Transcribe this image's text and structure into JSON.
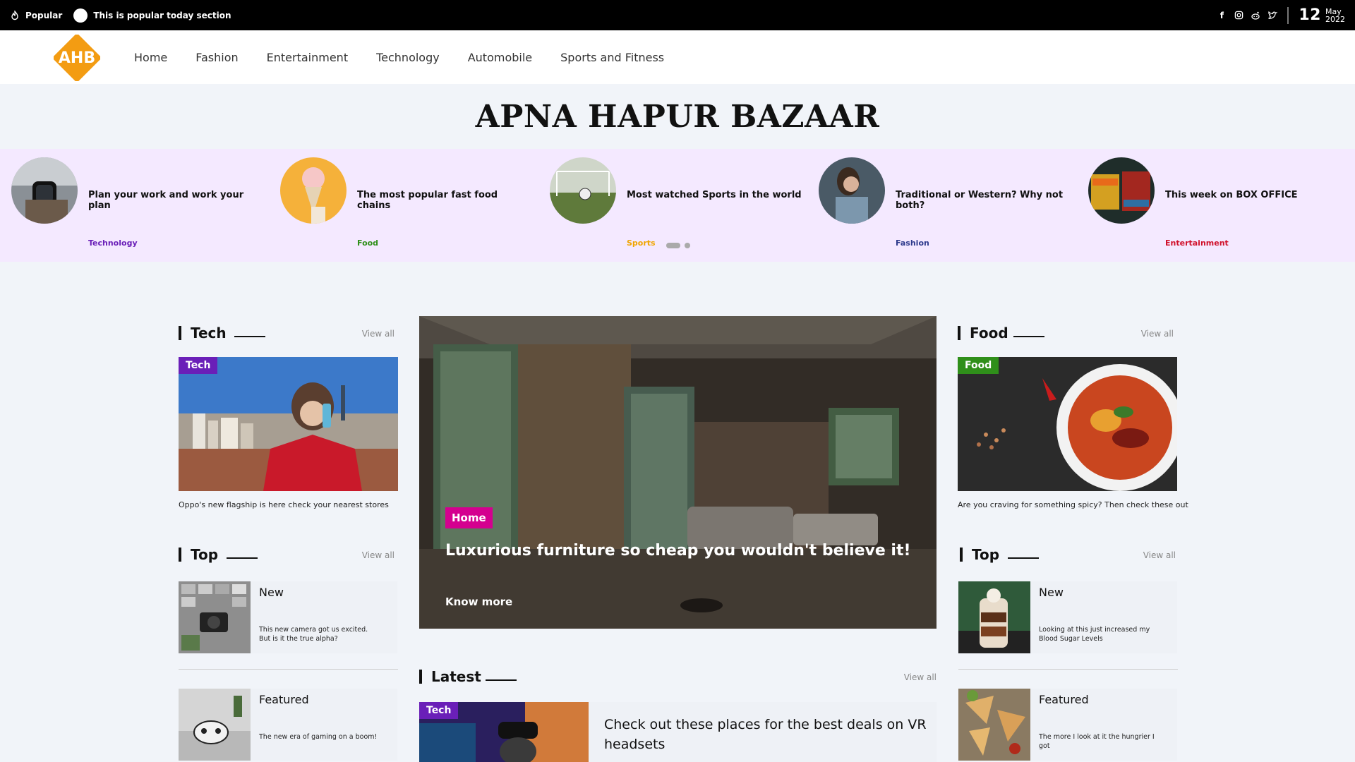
{
  "topbar": {
    "popular_label": "Popular",
    "popular_text": "This is popular today section",
    "social": [
      "facebook-icon",
      "instagram-icon",
      "reddit-icon",
      "twitter-icon"
    ],
    "date_day": "12",
    "date_month": "May",
    "date_year": "2022"
  },
  "logo": {
    "text": "AHB",
    "color": "#f39c12"
  },
  "nav": {
    "items": [
      "Home",
      "Fashion",
      "Entertainment",
      "Technology",
      "Automobile",
      "Sports and Fitness"
    ]
  },
  "site_title": "APNA HAPUR BAZAAR",
  "carousel": {
    "items": [
      {
        "title": "Plan your work and work your plan",
        "category": "Technology",
        "category_color": "#6a1fb8"
      },
      {
        "title": "The most popular fast food chains",
        "category": "Food",
        "category_color": "#2f8f1a"
      },
      {
        "title": "Most watched Sports in the world",
        "category": "Sports",
        "category_color": "#f0a500"
      },
      {
        "title": "Traditional or Western? Why not both?",
        "category": "Fashion",
        "category_color": "#2d3a8c"
      },
      {
        "title": "This week on BOX OFFICE",
        "category": "Entertainment",
        "category_color": "#d0102a"
      }
    ]
  },
  "tech": {
    "heading": "Tech",
    "view_all": "View all",
    "badge": "Tech",
    "badge_color": "#6a1fb8",
    "caption": "Oppo's new flagship is here check your nearest stores"
  },
  "top_left": {
    "heading": "Top",
    "view_all": "View all",
    "items": [
      {
        "title": "New",
        "desc": "This new camera got us excited. But is it the true alpha?"
      },
      {
        "title": "Featured",
        "desc": "The new era of gaming on a boom!"
      }
    ]
  },
  "hero": {
    "badge": "Home",
    "badge_color": "#d4008f",
    "title": "Luxurious furniture so cheap you wouldn't believe it!",
    "more": "Know more"
  },
  "latest": {
    "heading": "Latest",
    "view_all": "View all",
    "badge": "Tech",
    "badge_color": "#6a1fb8",
    "title": "Check out these places for the best deals on VR headsets"
  },
  "food": {
    "heading": "Food",
    "view_all": "View all",
    "badge": "Food",
    "badge_color": "#2f8f1a",
    "caption": "Are you craving for something spicy? Then check these out"
  },
  "top_right": {
    "heading": "Top",
    "view_all": "View all",
    "items": [
      {
        "title": "New",
        "desc": "Looking at this just increased my Blood Sugar Levels"
      },
      {
        "title": "Featured",
        "desc": "The more I look at it the hungrier I got"
      }
    ]
  }
}
